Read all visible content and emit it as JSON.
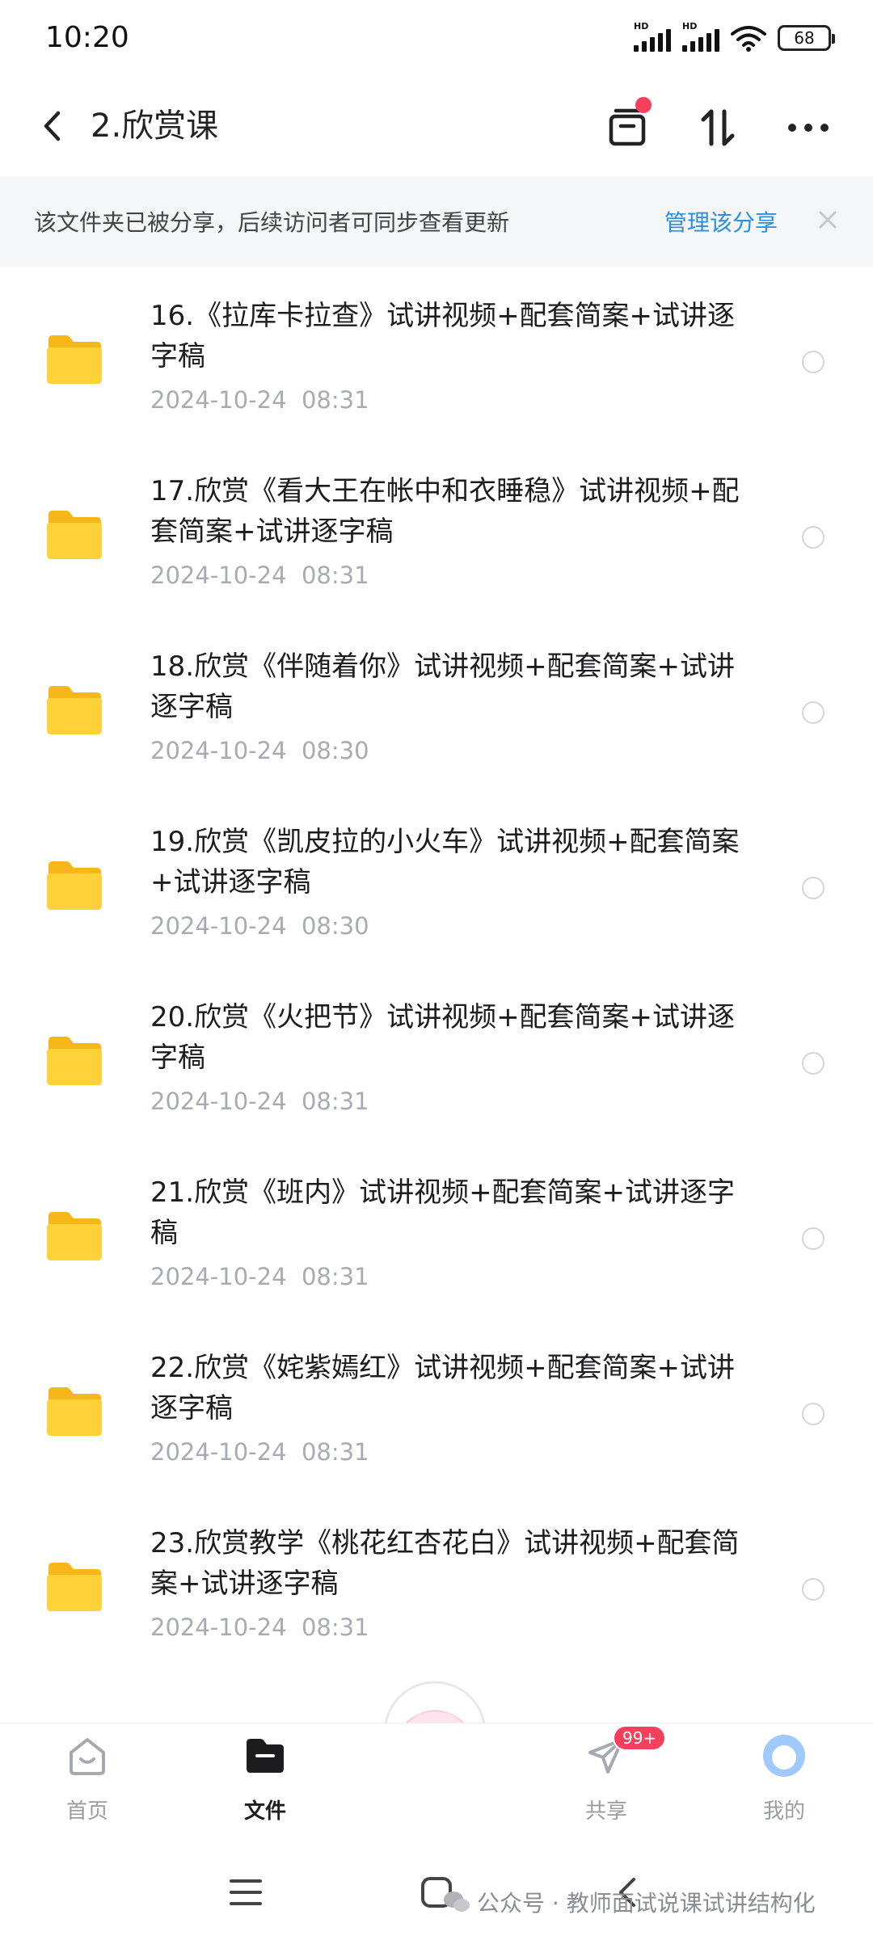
{
  "status_bar": {
    "time": "10:20",
    "signal_label": "HD",
    "battery": "68"
  },
  "header": {
    "title": "2.欣赏课"
  },
  "banner": {
    "text": "该文件夹已被分享，后续访问者可同步查看更新",
    "link": "管理该分享"
  },
  "files": [
    {
      "name": "16.《拉库卡拉查》试讲视频+配套简案+试讲逐字稿",
      "date": "2024-10-24  08:31"
    },
    {
      "name": "17.欣赏《看大王在帐中和衣睡稳》试讲视频+配套简案+试讲逐字稿",
      "date": "2024-10-24  08:31"
    },
    {
      "name": "18.欣赏《伴随着你》试讲视频+配套简案+试讲逐字稿",
      "date": "2024-10-24  08:30"
    },
    {
      "name": "19.欣赏《凯皮拉的小火车》试讲视频+配套简案+试讲逐字稿",
      "date": "2024-10-24  08:30"
    },
    {
      "name": "20.欣赏《火把节》试讲视频+配套简案+试讲逐字稿",
      "date": "2024-10-24  08:31"
    },
    {
      "name": "21.欣赏《班内》试讲视频+配套简案+试讲逐字稿",
      "date": "2024-10-24  08:31"
    },
    {
      "name": "22.欣赏《姹紫嫣红》试讲视频+配套简案+试讲逐字稿",
      "date": "2024-10-24  08:31"
    },
    {
      "name": "23.欣赏教学《桃花红杏花白》试讲视频+配套简案+试讲逐字稿",
      "date": "2024-10-24  08:31"
    }
  ],
  "nav": {
    "home": "首页",
    "files": "文件",
    "share": "共享",
    "share_badge": "99+",
    "mine": "我的"
  },
  "watermark": "公众号 · 教师面试说课试讲结构化",
  "colors": {
    "accent": "#2b8fe0",
    "badge": "#f4405d",
    "folder": "#ffcb2f"
  }
}
